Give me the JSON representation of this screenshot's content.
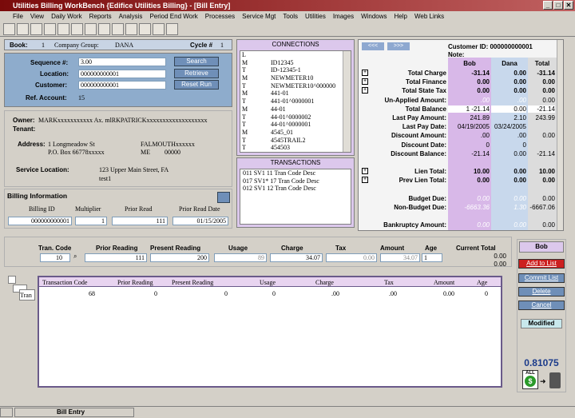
{
  "window": {
    "title": "Utilities Billing WorkBench {Edifice Utilities Billing} - [Bill Entry]",
    "status": "Bill Entry"
  },
  "menu": [
    "File",
    "View",
    "Daily Work",
    "Reports",
    "Analysis",
    "Period End Work",
    "Processes",
    "Service Mgt",
    "Tools",
    "Utilities",
    "Images",
    "Windows",
    "Help",
    "Web Links"
  ],
  "book": {
    "book_label": "Book:",
    "book_value": "1",
    "group_label": "Company Group:",
    "group_value": "DANA",
    "cycle_label": "Cycle #",
    "cycle_value": "1"
  },
  "search": {
    "seq_label": "Sequence #:",
    "seq_value": "3.00",
    "loc_label": "Location:",
    "loc_value": "000000000001",
    "cust_label": "Customer:",
    "cust_value": "000000000001",
    "ref_label": "Ref. Account:",
    "ref_value": "15",
    "search_btn": "Search",
    "retrieve_btn": "Retrieve",
    "reset_btn": "Reset Run"
  },
  "owner": {
    "owner_label": "Owner:",
    "owner_value": "MARKxxxxxxxxxxx Ax. mlRKPATRICKxxxxxxxxxxxxxxxxxxx",
    "tenant_label": "Tenant:",
    "addr_label": "Address:",
    "addr1": "1 Longmeadow St",
    "addr2": "P.O. Box 66778xxxxx",
    "city": "FALMOUTHxxxxxx",
    "state": "ME",
    "zip": "00000",
    "svc_label": "Service Location:",
    "svc1": "123 Upper Main Street, FA",
    "svc2": "test1"
  },
  "billing": {
    "title": "Billing Information",
    "h_id": "Billing ID",
    "h_mult": "Multiplier",
    "h_prior": "Prior Read",
    "h_date": "Prior Read Date",
    "v_id": "000000000001",
    "v_mult": "1",
    "v_prior": "111",
    "v_date": "01/15/2005"
  },
  "connections": {
    "title": "CONNECTIONS",
    "rows": [
      [
        "L",
        ""
      ],
      [
        "M",
        "ID12345"
      ],
      [
        "T",
        "ID-12345-1"
      ],
      [
        "M",
        "NEWMETER10"
      ],
      [
        "T",
        "NEWMETER10^000000"
      ],
      [
        "M",
        "441-01"
      ],
      [
        "T",
        "441-01^0000001"
      ],
      [
        "M",
        "44-01"
      ],
      [
        "T",
        "44-01^0000002"
      ],
      [
        "T",
        "44-01^0000001"
      ],
      [
        "M",
        "4545_01"
      ],
      [
        "T",
        "4545TRAIL2"
      ],
      [
        "T",
        "454503"
      ]
    ]
  },
  "transactions": {
    "title": "TRANSACTIONS",
    "rows": [
      "011  SV1    11 Tran Code Desc",
      "017  SV1*  17 Tran Code Desc",
      "012  SV1    12 Tran Code Desc"
    ]
  },
  "account": {
    "nav_prev": "<<<",
    "nav_next": ">>>",
    "cust_id_label": "Customer ID: 000000000001",
    "note_label": "Note:",
    "cols": [
      "Bob",
      "Dana",
      "Total"
    ],
    "rows": [
      {
        "plus": true,
        "label": "Total Charge",
        "v": [
          "-31.14",
          "0.00",
          "-31.14"
        ]
      },
      {
        "plus": true,
        "label": "Total Finance",
        "v": [
          "0.00",
          "0.00",
          "0.00"
        ]
      },
      {
        "plus": true,
        "label": "Total State Tax",
        "v": [
          "0.00",
          "0.00",
          "0.00"
        ]
      },
      {
        "plus": false,
        "label": "Un-Applied Amount:",
        "v": [
          ".00",
          ".00",
          "0.00"
        ]
      },
      {
        "plus": false,
        "label": "Total Balance",
        "v": [
          "1     -21.14",
          "0.00",
          "-21.14"
        ]
      },
      {
        "plus": false,
        "label": "Last Pay Amount:",
        "v": [
          "241.89",
          "2.10",
          "243.99"
        ]
      },
      {
        "plus": false,
        "label": "Last Pay Date:",
        "v": [
          "04/19/2005",
          "03/24/2005",
          ""
        ]
      },
      {
        "plus": false,
        "label": "Discount Amount:",
        "v": [
          ".00",
          ".00",
          "0.00"
        ]
      },
      {
        "plus": false,
        "label": "Discount Date:",
        "v": [
          "0",
          "0",
          ""
        ]
      },
      {
        "plus": false,
        "label": "Discount Balance:",
        "v": [
          "-21.14",
          "0.00",
          "-21.14"
        ]
      },
      {
        "plus": false,
        "label": "",
        "v": [
          "",
          "",
          ""
        ]
      },
      {
        "plus": true,
        "label": "Lien Total:",
        "v": [
          "10.00",
          "0.00",
          "10.00"
        ]
      },
      {
        "plus": true,
        "label": "Prev Lien Total:",
        "v": [
          "0.00",
          "0.00",
          "0.00"
        ]
      },
      {
        "plus": false,
        "label": "",
        "v": [
          "",
          "",
          ""
        ]
      },
      {
        "plus": false,
        "label": "Budget Due:",
        "v": [
          "0.00",
          "0.00",
          "0.00"
        ]
      },
      {
        "plus": false,
        "label": "Non-Budget Due:",
        "v": [
          "-6663.36",
          "1.30",
          "-6667.06"
        ]
      },
      {
        "plus": false,
        "label": "",
        "v": [
          "",
          "",
          ""
        ]
      },
      {
        "plus": false,
        "label": "Bankruptcy Amount:",
        "v": [
          "0.00",
          "0.00",
          "0.00"
        ]
      }
    ]
  },
  "entry": {
    "h_code": "Tran. Code",
    "h_prior": "Prior Reading",
    "h_present": "Present Reading",
    "h_usage": "Usage",
    "h_charge": "Charge",
    "h_tax": "Tax",
    "h_amount": "Amount",
    "h_age": "Age",
    "h_current": "Current Total",
    "v_code": "10",
    "v_prior": "111",
    "v_present": "200",
    "v_usage": "89",
    "v_charge": "34.07",
    "v_tax": "0.00",
    "v_amount": "34.07",
    "v_age": "1",
    "current1": "0.00",
    "current2": "0.00"
  },
  "grid": {
    "tab": "Tran",
    "headers": [
      "Transaction Code",
      "Prior Reading",
      "Present Reading",
      "Usage",
      "Charge",
      "Tax",
      "Amount",
      "Age"
    ],
    "row": [
      "68",
      "0",
      "0",
      "0",
      ".00",
      ".00",
      "0.00",
      "0"
    ]
  },
  "side": {
    "name": "Bob",
    "add": "Add to List",
    "commit": "Commit List",
    "delete": "Delete",
    "cancel": "Cancel",
    "modified": "Modified",
    "amount": "0.81075",
    "all": "ALL"
  }
}
